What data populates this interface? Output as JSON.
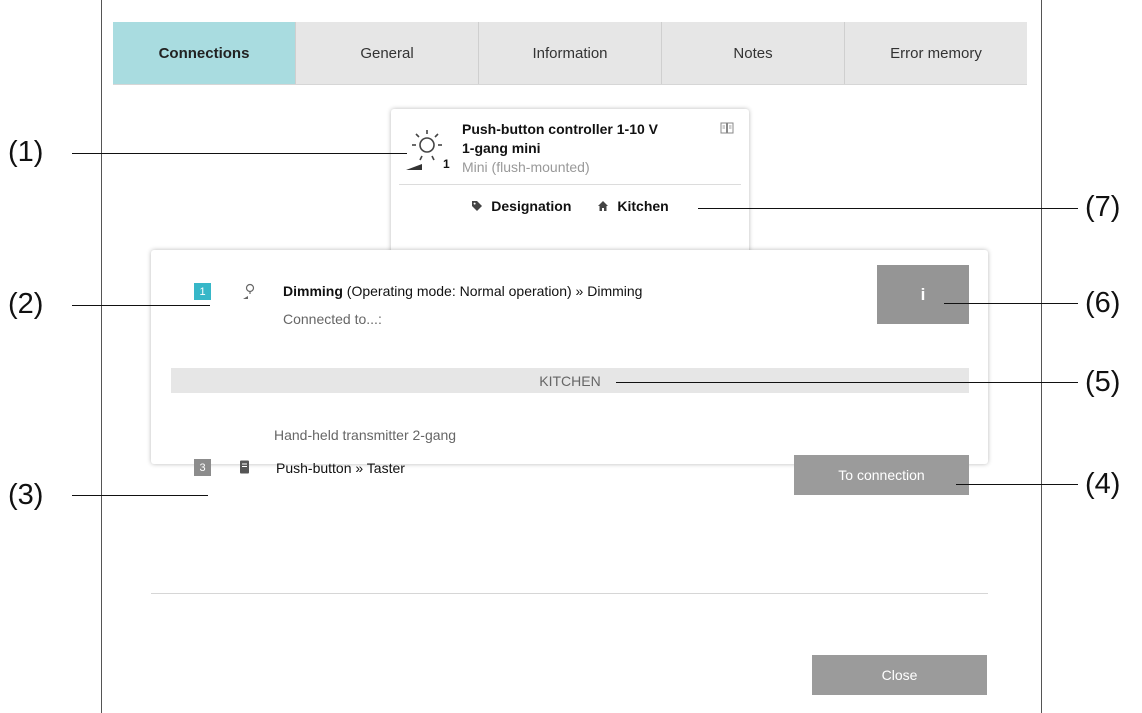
{
  "tabs": [
    {
      "label": "Connections",
      "active": true
    },
    {
      "label": "General",
      "active": false
    },
    {
      "label": "Information",
      "active": false
    },
    {
      "label": "Notes",
      "active": false
    },
    {
      "label": "Error memory",
      "active": false
    }
  ],
  "device": {
    "title_line1": "Push-button controller 1-10 V",
    "title_line2": "1-gang mini",
    "subtitle": "Mini (flush-mounted)",
    "icon_number": "1",
    "designation_label": "Designation",
    "room_label": "Kitchen",
    "icons": [
      "dimmer-light-icon",
      "manual-book-icon",
      "tag-icon",
      "house-icon"
    ]
  },
  "channel": {
    "number": "1",
    "name": "Dimming",
    "detail": " (Operating mode: Normal operation) » Dimming",
    "connected_to": "Connected to...:",
    "info_button": "i",
    "icon": "lamp-icon"
  },
  "connection": {
    "room_header": "KITCHEN",
    "device_name": "Hand-held transmitter 2-gang",
    "number": "3",
    "channel_label": "Push-button » Taster",
    "button_label": "To connection",
    "icon": "remote-control-icon"
  },
  "footer": {
    "close_label": "Close"
  },
  "callouts": {
    "c1": "(1)",
    "c2": "(2)",
    "c3": "(3)",
    "c4": "(4)",
    "c5": "(5)",
    "c6": "(6)",
    "c7": "(7)"
  },
  "colors": {
    "active_tab": "#a9dce0",
    "tab_bar": "#e6e6e6",
    "badge_teal": "#37b7c8",
    "button_grey": "#9b9b9b"
  }
}
